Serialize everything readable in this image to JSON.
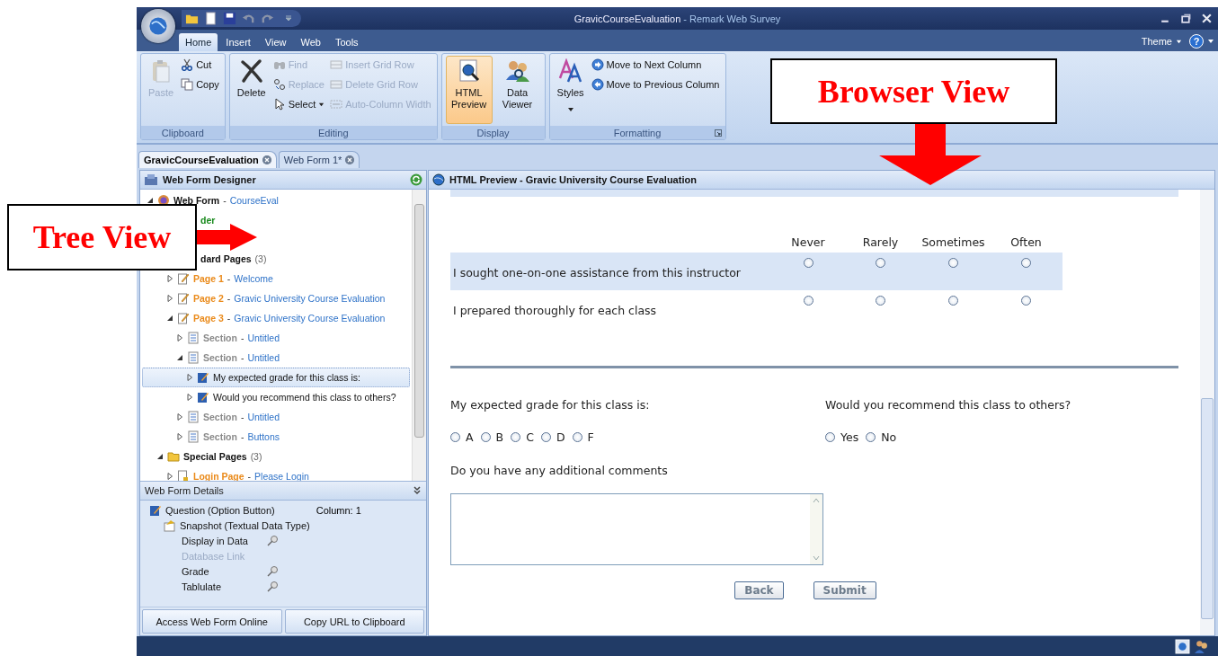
{
  "window": {
    "title": "GravicCourseEvaluation",
    "app_name": "- Remark Web Survey"
  },
  "ribbon_tabs": [
    {
      "label": "Home",
      "selected": true
    },
    {
      "label": "Insert",
      "selected": false
    },
    {
      "label": "View",
      "selected": false
    },
    {
      "label": "Web",
      "selected": false
    },
    {
      "label": "Tools",
      "selected": false
    }
  ],
  "theme_menu": {
    "label": "Theme",
    "help": "?"
  },
  "ribbon_groups": [
    {
      "label": "Clipboard",
      "commands": [
        {
          "kind": "large",
          "label": "Paste",
          "disabled": true
        },
        {
          "kind": "small",
          "label": "Cut",
          "disabled": false
        },
        {
          "kind": "small",
          "label": "Copy",
          "disabled": false
        }
      ]
    },
    {
      "label": "Editing",
      "commands": [
        {
          "kind": "large",
          "label": "Delete",
          "disabled": false
        },
        {
          "kind": "small",
          "label": "Find",
          "disabled": true
        },
        {
          "kind": "small",
          "label": "Replace",
          "disabled": true
        },
        {
          "kind": "small",
          "label": "Select",
          "disabled": false,
          "dropdown": true
        },
        {
          "kind": "small",
          "label": "Insert Grid Row",
          "disabled": true
        },
        {
          "kind": "small",
          "label": "Delete Grid Row",
          "disabled": true
        },
        {
          "kind": "small",
          "label": "Auto-Column Width",
          "disabled": true
        }
      ]
    },
    {
      "label": "Display",
      "commands": [
        {
          "kind": "large",
          "label": "HTML Preview",
          "disabled": false,
          "selected": true
        },
        {
          "kind": "large",
          "label": "Data Viewer",
          "disabled": false,
          "selected": false
        }
      ]
    },
    {
      "label": "Formatting",
      "launcher": true,
      "commands": [
        {
          "kind": "large",
          "label": "Styles",
          "disabled": false,
          "dropdown": true
        },
        {
          "kind": "small",
          "label": "Move to Next Column",
          "disabled": false
        },
        {
          "kind": "small",
          "label": "Move to Previous Column",
          "disabled": false
        }
      ]
    }
  ],
  "document_tabs": [
    {
      "label": "GravicCourseEvaluation",
      "selected": true
    },
    {
      "label": "Web Form 1*",
      "selected": false
    }
  ],
  "designer": {
    "title": "Web Form Designer",
    "tree": [
      {
        "kind": "form",
        "name": "Web Form",
        "sep": "-",
        "title": "CourseEval",
        "expanded": true,
        "selected": false,
        "children": [
          {
            "kind": "header",
            "name": "der",
            "selected": false
          },
          {
            "kind": "folder",
            "name": "dard Pages",
            "count": "(3)",
            "selected": false,
            "children": [
              {
                "kind": "page",
                "name": "Page 1",
                "sep": "-",
                "title": "Welcome",
                "expanded": false,
                "selected": false
              },
              {
                "kind": "page",
                "name": "Page 2",
                "sep": "-",
                "title": "Gravic University Course Evaluation",
                "expanded": false,
                "selected": false
              },
              {
                "kind": "page",
                "name": "Page 3",
                "sep": "-",
                "title": "Gravic University Course Evaluation",
                "expanded": true,
                "selected": false,
                "children": [
                  {
                    "kind": "section",
                    "name": "Section",
                    "sep": "-",
                    "title": "Untitled",
                    "expanded": false,
                    "selected": false
                  },
                  {
                    "kind": "section",
                    "name": "Section",
                    "sep": "-",
                    "title": "Untitled",
                    "expanded": true,
                    "selected": false,
                    "children": [
                      {
                        "kind": "question",
                        "name": "My expected grade for this class is:",
                        "expanded": false,
                        "selected": true
                      },
                      {
                        "kind": "question",
                        "name": "Would you recommend this class to others?",
                        "expanded": false,
                        "selected": false
                      }
                    ]
                  },
                  {
                    "kind": "section",
                    "name": "Section",
                    "sep": "-",
                    "title": "Untitled",
                    "expanded": false,
                    "selected": false
                  },
                  {
                    "kind": "section",
                    "name": "Section",
                    "sep": "-",
                    "title": "Buttons",
                    "expanded": false,
                    "selected": false
                  }
                ]
              }
            ]
          },
          {
            "kind": "special-folder",
            "name": "Special Pages",
            "count": "(3)",
            "expanded": true,
            "selected": false,
            "children": [
              {
                "kind": "login",
                "name": "Login Page",
                "sep": "-",
                "title": "Please Login",
                "expanded": false,
                "selected": false
              }
            ]
          }
        ]
      }
    ]
  },
  "details": {
    "title": "Web Form Details",
    "lines": [
      {
        "kind": "question",
        "label": "Question (Option Button)",
        "extra": "Column: 1"
      },
      {
        "kind": "snapshot",
        "label": "Snapshot (Textual Data Type)"
      },
      {
        "kind": "property",
        "label": "Display in Data",
        "pinned": true,
        "disabled": false
      },
      {
        "kind": "property",
        "label": "Database Link",
        "pinned": false,
        "disabled": true
      },
      {
        "kind": "property",
        "label": "Grade",
        "pinned": true,
        "disabled": false
      },
      {
        "kind": "property",
        "label": "Tablulate",
        "pinned": true,
        "disabled": false
      }
    ],
    "buttons": [
      "Access Web Form Online",
      "Copy URL to Clipboard"
    ]
  },
  "preview": {
    "title": "HTML Preview - Gravic University Course Evaluation",
    "matrix": {
      "columns": [
        "Never",
        "Rarely",
        "Sometimes",
        "Often"
      ],
      "rows": [
        {
          "label": "I sought one-on-one assistance from this instructor",
          "shaded": true,
          "choices": [
            {
              "selected": false
            },
            {
              "selected": false
            },
            {
              "selected": false
            },
            {
              "selected": false
            }
          ]
        },
        {
          "label": "I prepared thoroughly for each class",
          "shaded": false,
          "choices": [
            {
              "selected": false
            },
            {
              "selected": false
            },
            {
              "selected": false
            },
            {
              "selected": false
            }
          ]
        }
      ]
    },
    "questions": [
      {
        "label": "My expected grade for this class is:",
        "options": [
          {
            "label": "A",
            "selected": false
          },
          {
            "label": "B",
            "selected": false
          },
          {
            "label": "C",
            "selected": false
          },
          {
            "label": "D",
            "selected": false
          },
          {
            "label": "F",
            "selected": false
          }
        ]
      },
      {
        "label": "Would you recommend this class to others?",
        "options": [
          {
            "label": "Yes",
            "selected": false
          },
          {
            "label": "No",
            "selected": false
          }
        ]
      }
    ],
    "comments": {
      "label": "Do you have any additional comments"
    },
    "buttons": [
      "Back",
      "Submit"
    ]
  },
  "callouts": [
    {
      "text": "Tree View"
    },
    {
      "text": "Browser View"
    }
  ]
}
